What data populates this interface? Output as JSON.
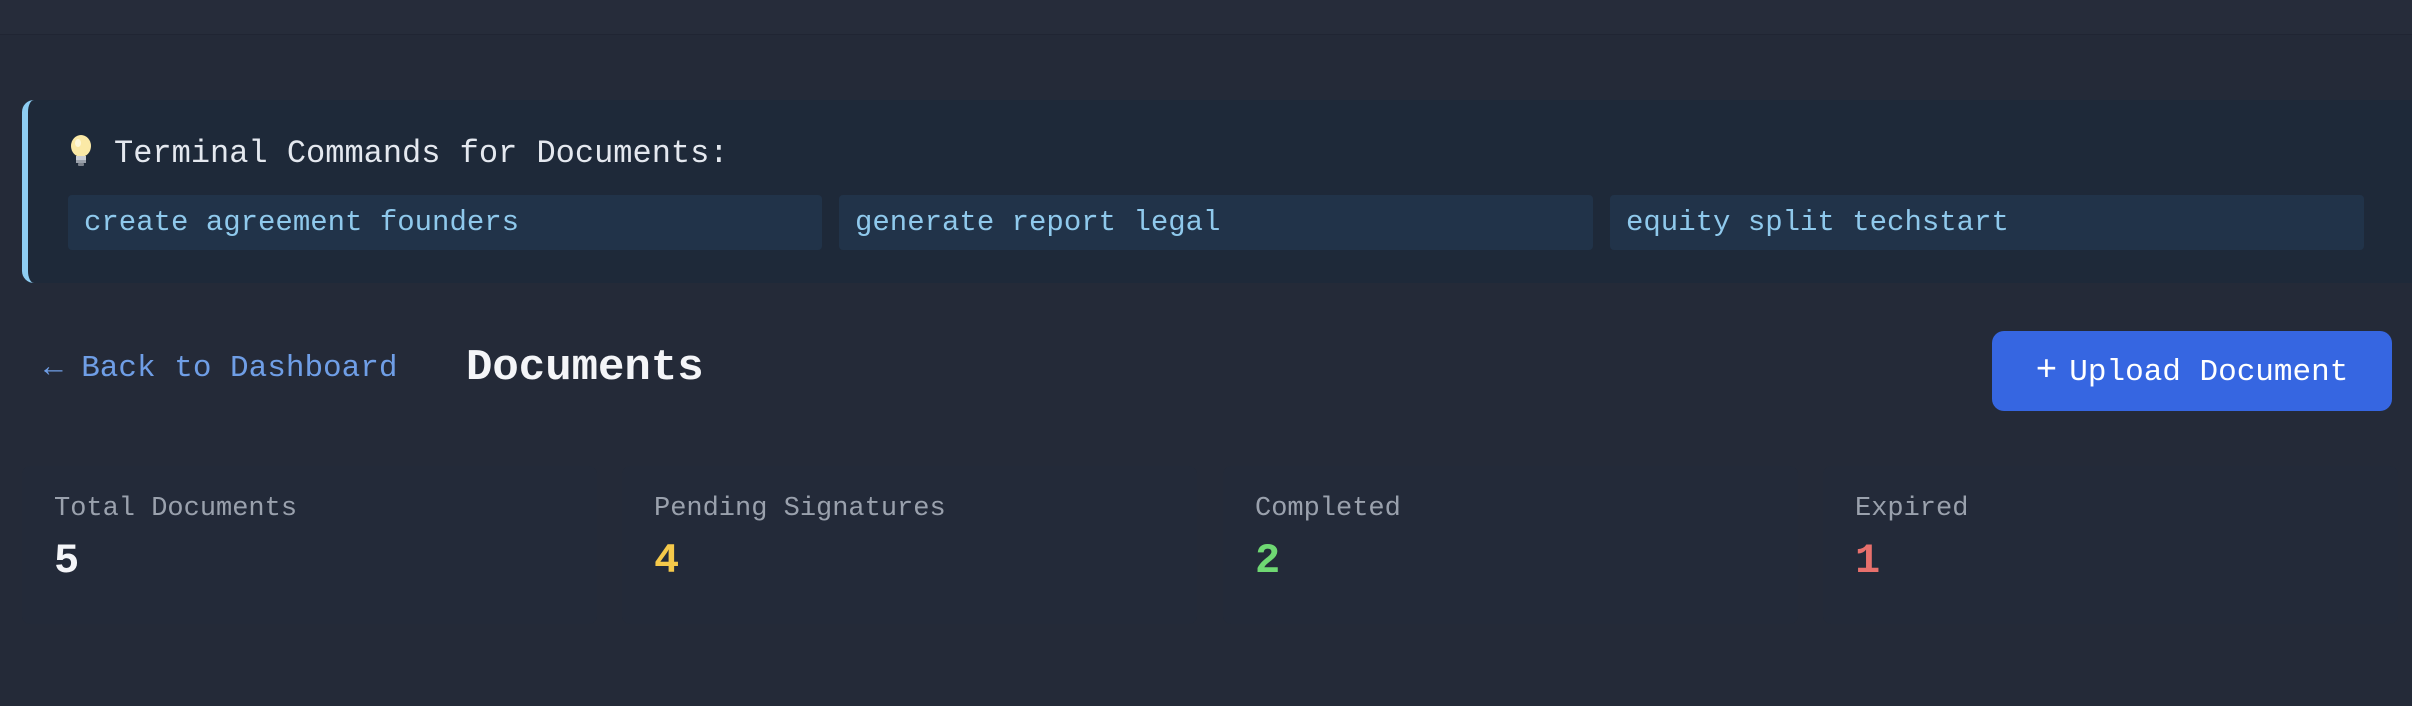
{
  "tips": {
    "icon": "lightbulb-icon",
    "title": "Terminal Commands for Documents:",
    "commands": [
      "create agreement founders",
      "generate report legal",
      "equity split techstart"
    ]
  },
  "header": {
    "back_label": "← Back to Dashboard",
    "title": "Documents",
    "upload_icon": "plus-icon",
    "upload_plus": "+",
    "upload_label": "Upload Document"
  },
  "stats": [
    {
      "label": "Total Documents",
      "value": "5",
      "color": "#f4f5f8"
    },
    {
      "label": "Pending Signatures",
      "value": "4",
      "color": "#f5c94a"
    },
    {
      "label": "Completed",
      "value": "2",
      "color": "#6fd873"
    },
    {
      "label": "Expired",
      "value": "1",
      "color": "#e8706c"
    }
  ],
  "colors": {
    "background": "#242a38",
    "tip_accent": "#8ecdf2",
    "command_text": "#8fc9ec",
    "link": "#6f9ee6",
    "primary_button": "#3666e1"
  }
}
